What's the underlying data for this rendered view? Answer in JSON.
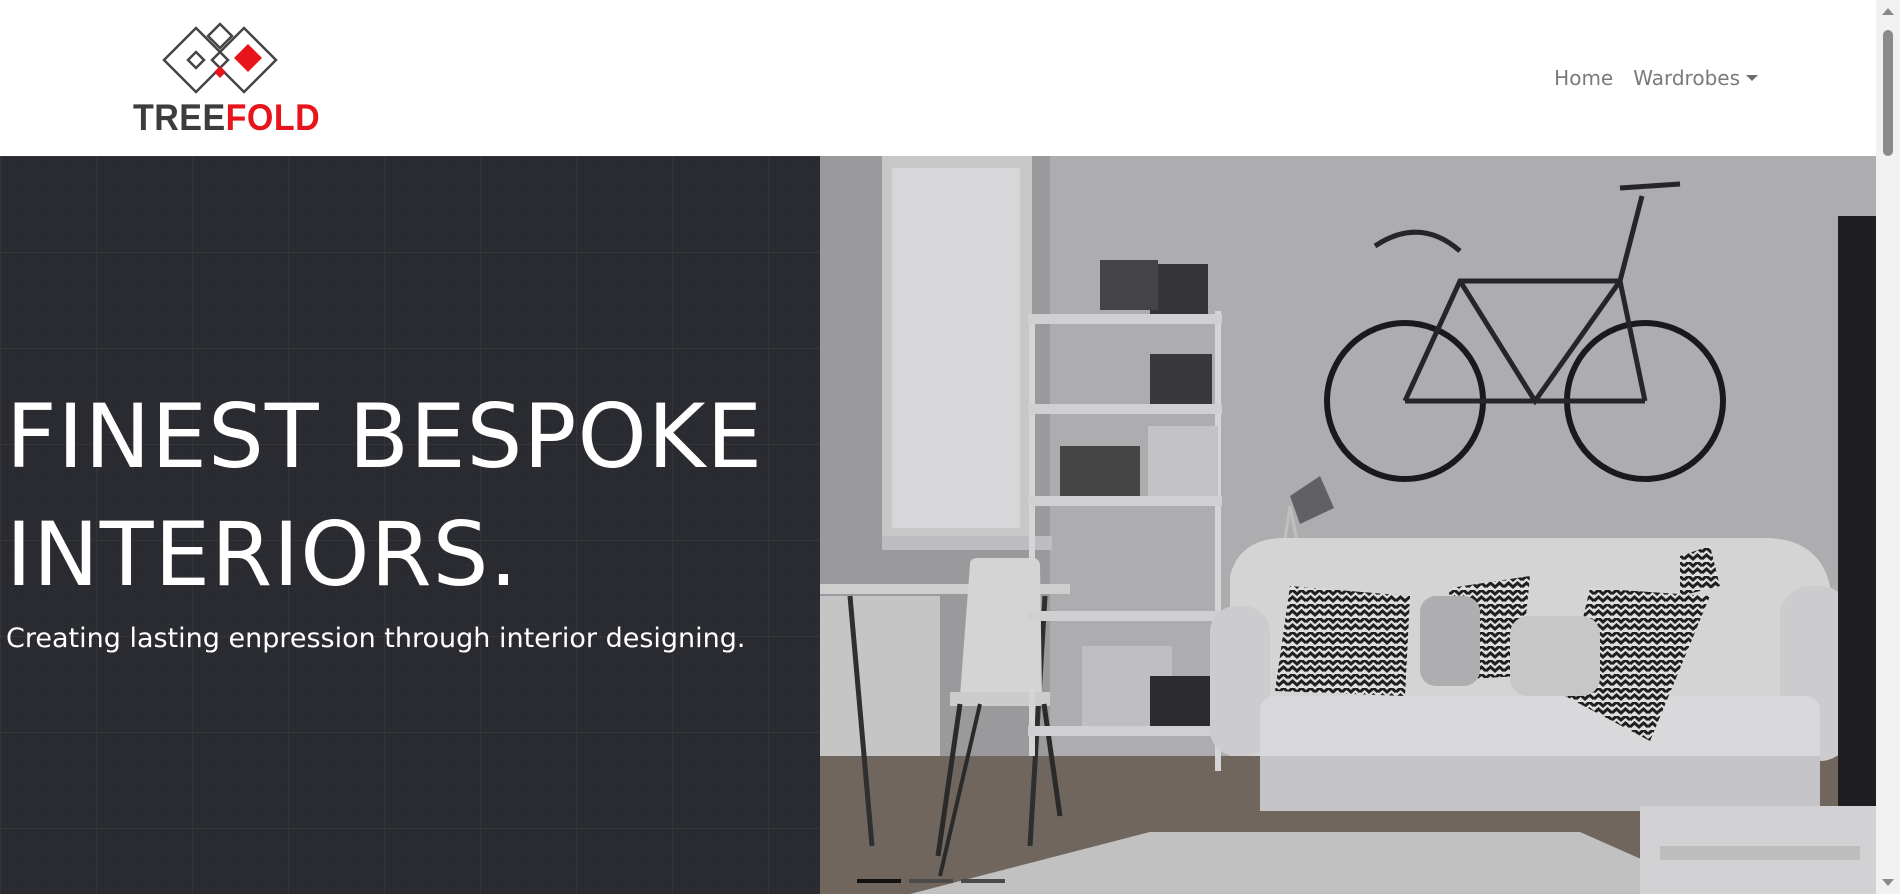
{
  "brand": {
    "logo_text_part1": "TREE",
    "logo_text_part2": "FOLD",
    "accent_color": "#e8141b"
  },
  "nav": {
    "items": [
      {
        "label": "Home"
      },
      {
        "label": "Wardrobes",
        "has_dropdown": true
      }
    ]
  },
  "hero": {
    "title_line1": "FINEST BESPOKE",
    "title_line2": "INTERIORS.",
    "subtitle": "Creating lasting enpression through interior designing.",
    "carousel": {
      "slide_count": 3,
      "active_index": 0
    }
  }
}
